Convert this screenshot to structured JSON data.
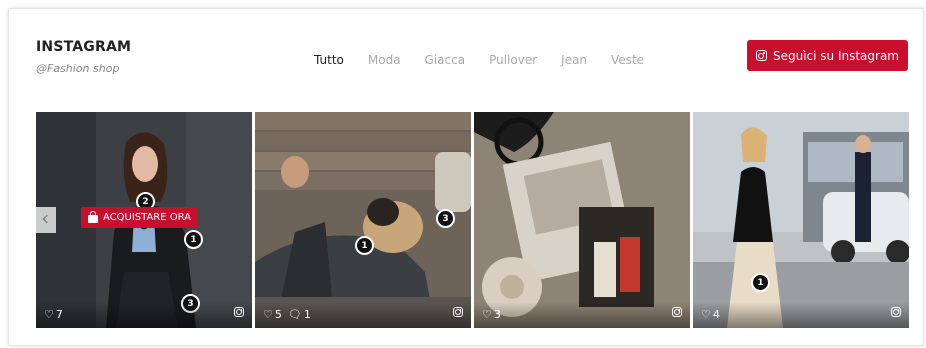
{
  "header": {
    "title": "INSTAGRAM",
    "subtitle": "@Fashion shop",
    "follow_button": {
      "label": "Seguìci su Instagram",
      "icon": "instagram-icon"
    }
  },
  "filters": [
    {
      "label": "Tutto",
      "active": true
    },
    {
      "label": "Moda",
      "active": false
    },
    {
      "label": "Giacca",
      "active": false
    },
    {
      "label": "Pullover",
      "active": false
    },
    {
      "label": "Jean",
      "active": false
    },
    {
      "label": "Veste",
      "active": false
    }
  ],
  "tiles": [
    {
      "scene": "woman-leather-jacket",
      "likes": "7",
      "comments": "",
      "hotspots": [
        "2",
        "1",
        "3"
      ],
      "buy_label": "ACQUISTARE ORA"
    },
    {
      "scene": "man-with-pug",
      "likes": "5",
      "comments": "1",
      "hotspots": [
        "1",
        "3"
      ]
    },
    {
      "scene": "flatlay-accessories",
      "likes": "3",
      "comments": "",
      "hotspots": []
    },
    {
      "scene": "woman-street-black-dress",
      "likes": "4",
      "comments": "",
      "hotspots": [
        "1"
      ]
    }
  ],
  "colors": {
    "accent": "#c8102e",
    "text": "#222222",
    "muted": "#aaaaaa"
  }
}
